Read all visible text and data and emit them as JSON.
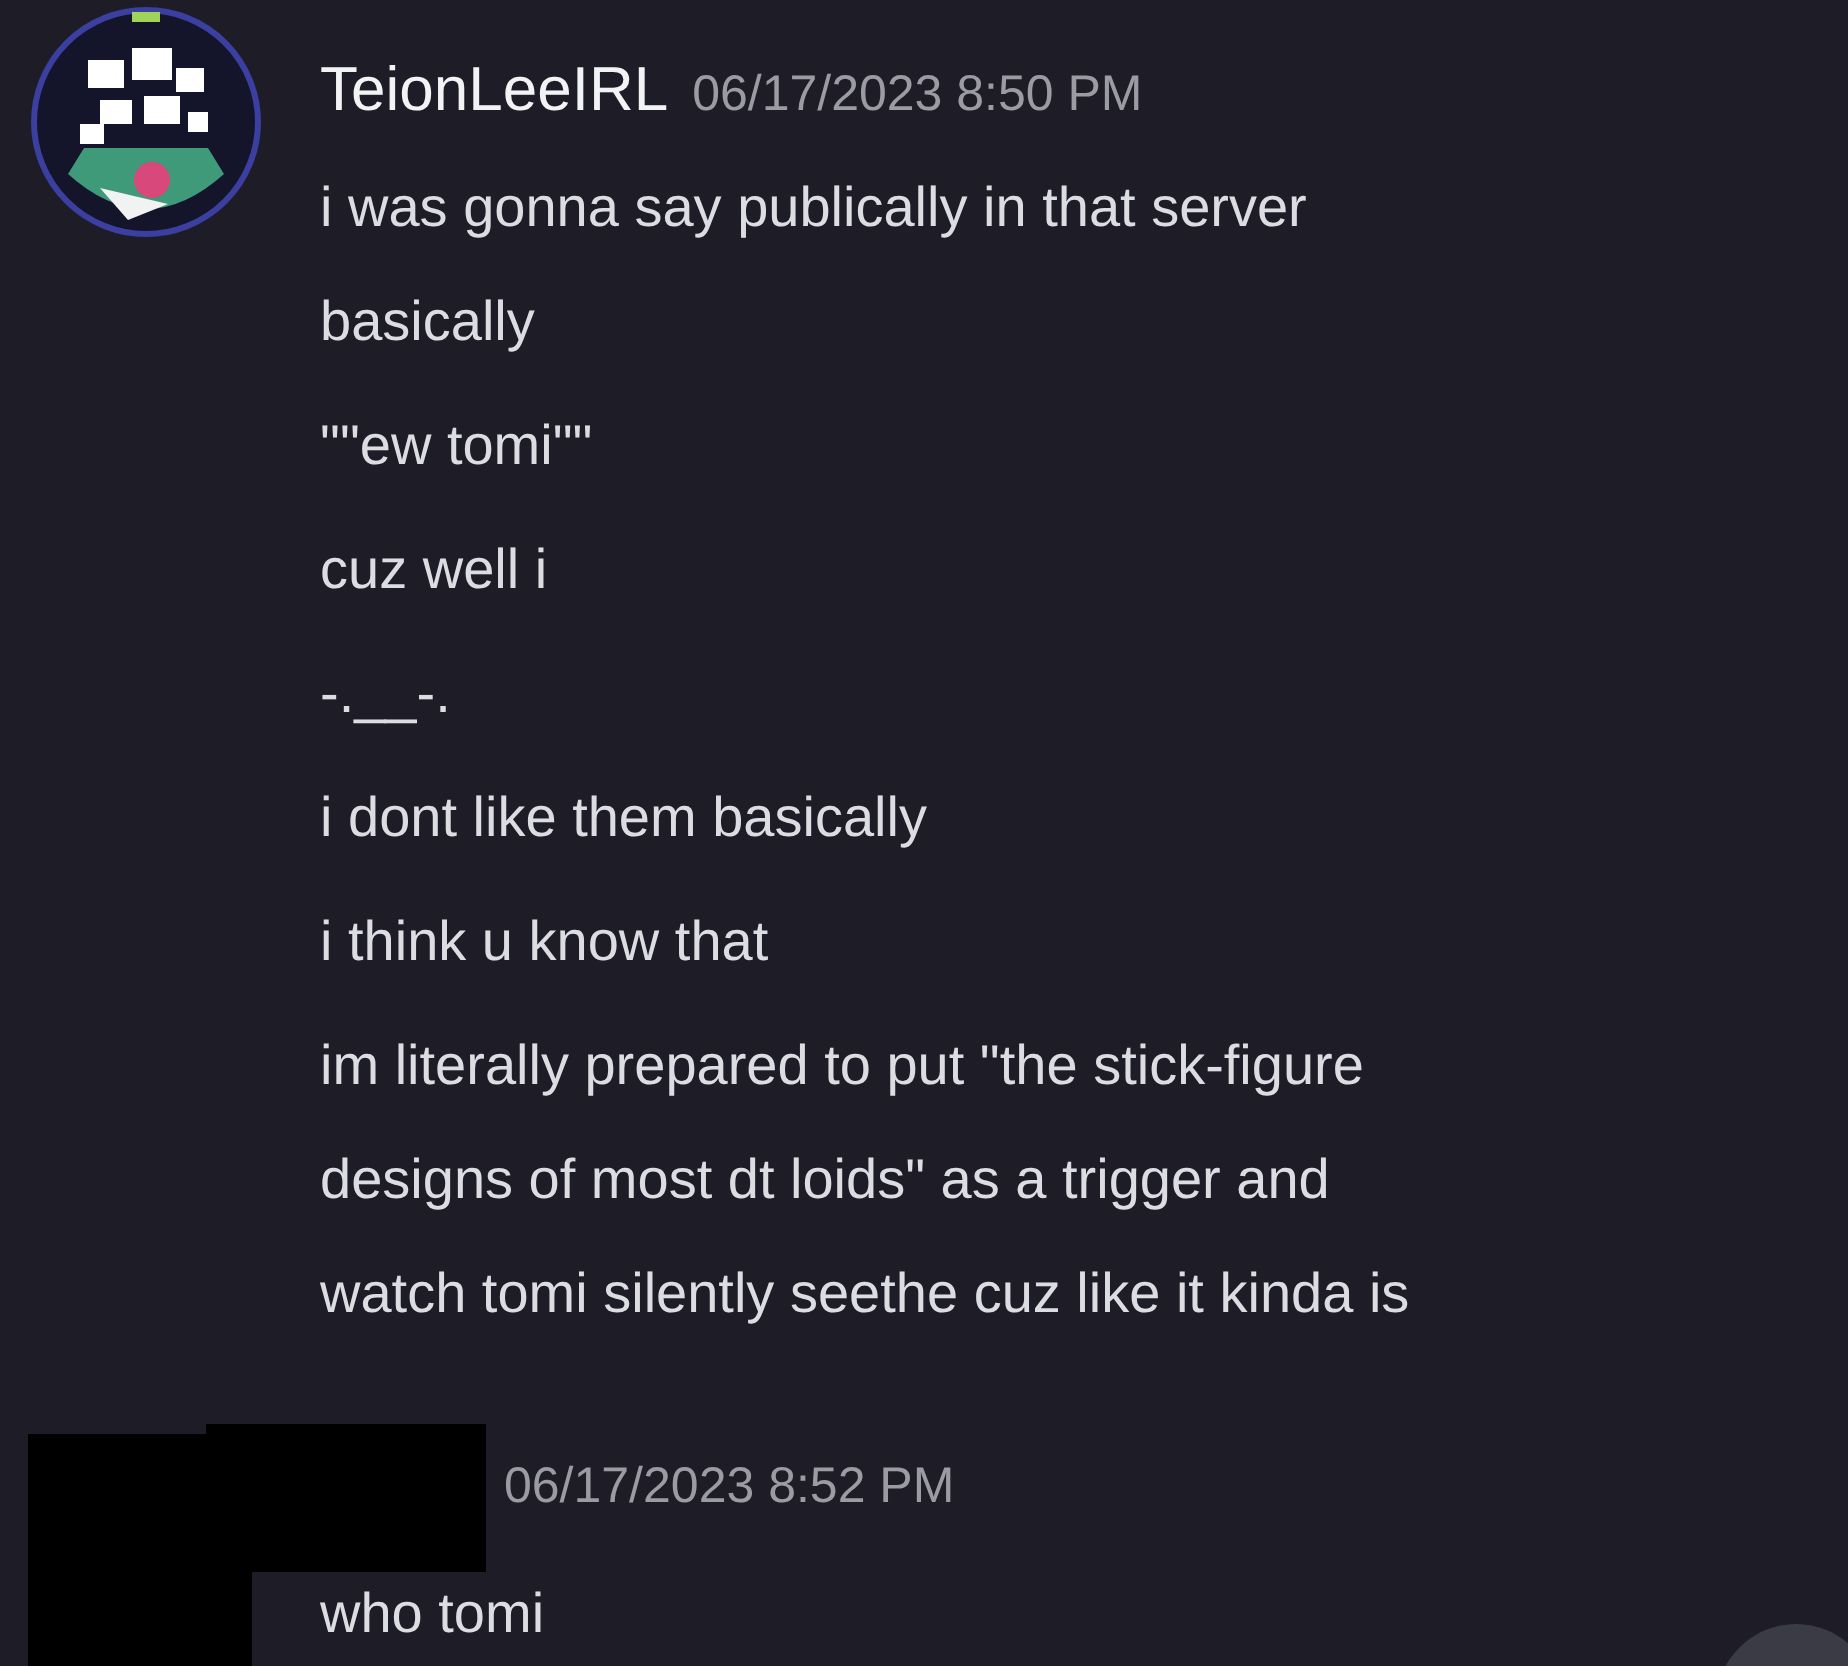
{
  "messages": [
    {
      "author": "TeionLeeIRL",
      "timestamp": "06/17/2023 8:50 PM",
      "redacted": false,
      "lines": [
        {
          "text": [
            "i was gonna say publically in that server",
            "basically"
          ]
        },
        {
          "text": [
            "\"\"ew tomi\"\""
          ]
        },
        {
          "text": [
            "cuz well i"
          ]
        },
        {
          "text": [
            "-.__-."
          ]
        },
        {
          "text": [
            "i dont like them basically"
          ]
        },
        {
          "text": [
            "i think  u know that"
          ]
        },
        {
          "text": [
            "im literally prepared to put \"the stick-figure",
            "designs of most dt loids\" as a trigger and",
            "watch tomi silently seethe cuz like it kinda is"
          ]
        }
      ]
    },
    {
      "timestamp": "06/17/2023 8:52 PM",
      "redacted": true,
      "lines": [
        {
          "text": [
            "who tomi"
          ]
        }
      ]
    }
  ]
}
